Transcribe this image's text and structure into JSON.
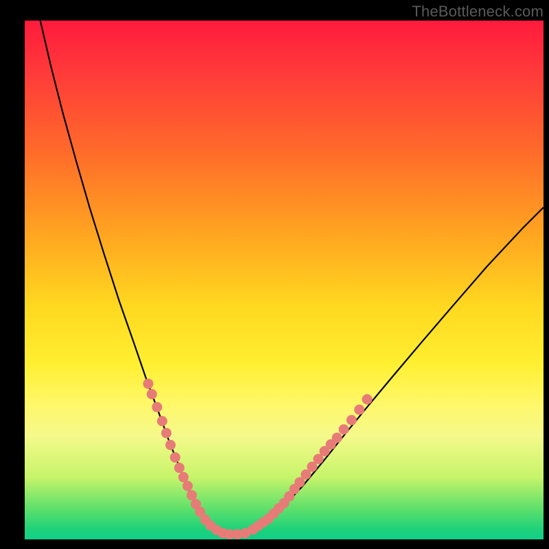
{
  "watermark": "TheBottleneck.com",
  "colors": {
    "frame": "#000000",
    "curve": "#000000",
    "dots": "#e77b77",
    "gradient_stops": [
      "#ff1a3c",
      "#ff3a3a",
      "#ff6a2a",
      "#ffa820",
      "#ffd820",
      "#ffef30",
      "#fff86a",
      "#f5f98a",
      "#c7f46a",
      "#5fe06a",
      "#1fd27a",
      "#10cf88"
    ]
  },
  "chart_data": {
    "type": "line",
    "title": "",
    "xlabel": "",
    "ylabel": "",
    "xlim": [
      0,
      100
    ],
    "ylim": [
      0,
      100
    ],
    "grid": false,
    "legend": false,
    "series": [
      {
        "name": "curve",
        "x": [
          3.0,
          5.1,
          7.4,
          9.9,
          12.5,
          15.3,
          18.2,
          21.0,
          23.4,
          26.0,
          27.8,
          29.4,
          30.8,
          32.1,
          33.3,
          35.0,
          37.0,
          39.0,
          41.5,
          44.0,
          47.0,
          50.0,
          53.5,
          57.5,
          61.5,
          66.0,
          71.0,
          76.5,
          82.5,
          89.0,
          96.0,
          100.0
        ],
        "y": [
          100.0,
          91.0,
          82.0,
          73.0,
          64.0,
          55.0,
          46.0,
          38.0,
          31.0,
          24.0,
          19.0,
          15.0,
          11.5,
          8.5,
          6.0,
          3.5,
          1.8,
          1.0,
          1.0,
          1.8,
          3.7,
          6.5,
          10.2,
          15.0,
          20.0,
          25.5,
          31.5,
          38.0,
          45.0,
          52.5,
          60.0,
          64.0
        ]
      }
    ],
    "markers": {
      "name": "highlight-dots",
      "color": "#e77b77",
      "points": [
        {
          "x": 23.8,
          "y": 30.0
        },
        {
          "x": 24.5,
          "y": 28.0
        },
        {
          "x": 25.5,
          "y": 25.5
        },
        {
          "x": 26.5,
          "y": 22.8
        },
        {
          "x": 27.3,
          "y": 20.5
        },
        {
          "x": 28.1,
          "y": 18.2
        },
        {
          "x": 29.0,
          "y": 15.8
        },
        {
          "x": 29.8,
          "y": 13.8
        },
        {
          "x": 30.6,
          "y": 12.0
        },
        {
          "x": 31.4,
          "y": 10.3
        },
        {
          "x": 32.2,
          "y": 8.5
        },
        {
          "x": 33.0,
          "y": 6.8
        },
        {
          "x": 33.8,
          "y": 5.3
        },
        {
          "x": 34.8,
          "y": 3.8
        },
        {
          "x": 35.8,
          "y": 2.7
        },
        {
          "x": 37.0,
          "y": 1.8
        },
        {
          "x": 38.2,
          "y": 1.2
        },
        {
          "x": 39.5,
          "y": 1.0
        },
        {
          "x": 41.0,
          "y": 1.0
        },
        {
          "x": 42.5,
          "y": 1.2
        },
        {
          "x": 44.0,
          "y": 1.9
        },
        {
          "x": 45.0,
          "y": 2.6
        },
        {
          "x": 46.0,
          "y": 3.3
        },
        {
          "x": 47.0,
          "y": 4.0
        },
        {
          "x": 48.0,
          "y": 5.0
        },
        {
          "x": 49.0,
          "y": 6.0
        },
        {
          "x": 50.0,
          "y": 7.0
        },
        {
          "x": 51.0,
          "y": 8.3
        },
        {
          "x": 52.0,
          "y": 9.7
        },
        {
          "x": 53.0,
          "y": 11.0
        },
        {
          "x": 54.2,
          "y": 12.5
        },
        {
          "x": 55.4,
          "y": 14.0
        },
        {
          "x": 56.6,
          "y": 15.5
        },
        {
          "x": 57.8,
          "y": 17.0
        },
        {
          "x": 59.0,
          "y": 18.3
        },
        {
          "x": 60.2,
          "y": 19.6
        },
        {
          "x": 61.5,
          "y": 21.2
        },
        {
          "x": 63.0,
          "y": 23.0
        },
        {
          "x": 64.5,
          "y": 25.0
        },
        {
          "x": 66.0,
          "y": 27.0
        }
      ]
    }
  }
}
